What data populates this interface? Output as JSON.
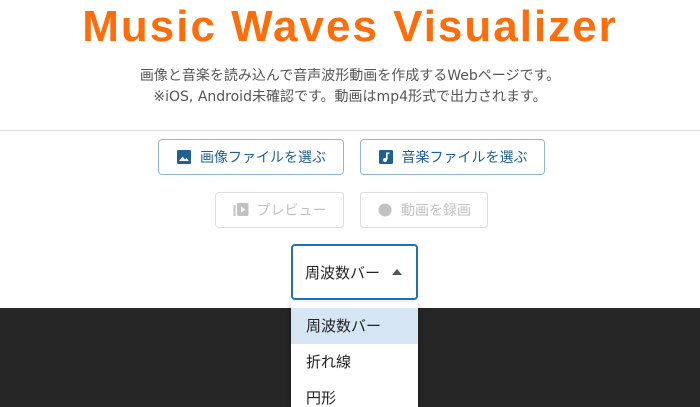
{
  "title": "Music Waves Visualizer",
  "description": {
    "line1": "画像と音楽を読み込んで音声波形動画を作成するWebページです。",
    "line2": "※iOS, Android未確認です。動画はmp4形式で出力されます。"
  },
  "buttons": {
    "select_image": "画像ファイルを選ぶ",
    "select_music": "音楽ファイルを選ぶ",
    "preview": "プレビュー",
    "record": "動画を録画"
  },
  "visualizer_select": {
    "selected": "周波数バー",
    "options": [
      "周波数バー",
      "折れ線",
      "円形"
    ]
  },
  "colors": {
    "title": "#ff6d0a",
    "primary_border": "#8fb6d6",
    "primary_text": "#1e5f94",
    "select_border": "#1f6fbd",
    "selected_option_bg": "#d6e6f5",
    "canvas_bg": "#262626"
  },
  "icons": {
    "select_image": "image-icon",
    "select_music": "music-note-icon",
    "preview": "play-video-icon",
    "record": "record-circle-icon",
    "dropdown": "caret-up-icon"
  }
}
